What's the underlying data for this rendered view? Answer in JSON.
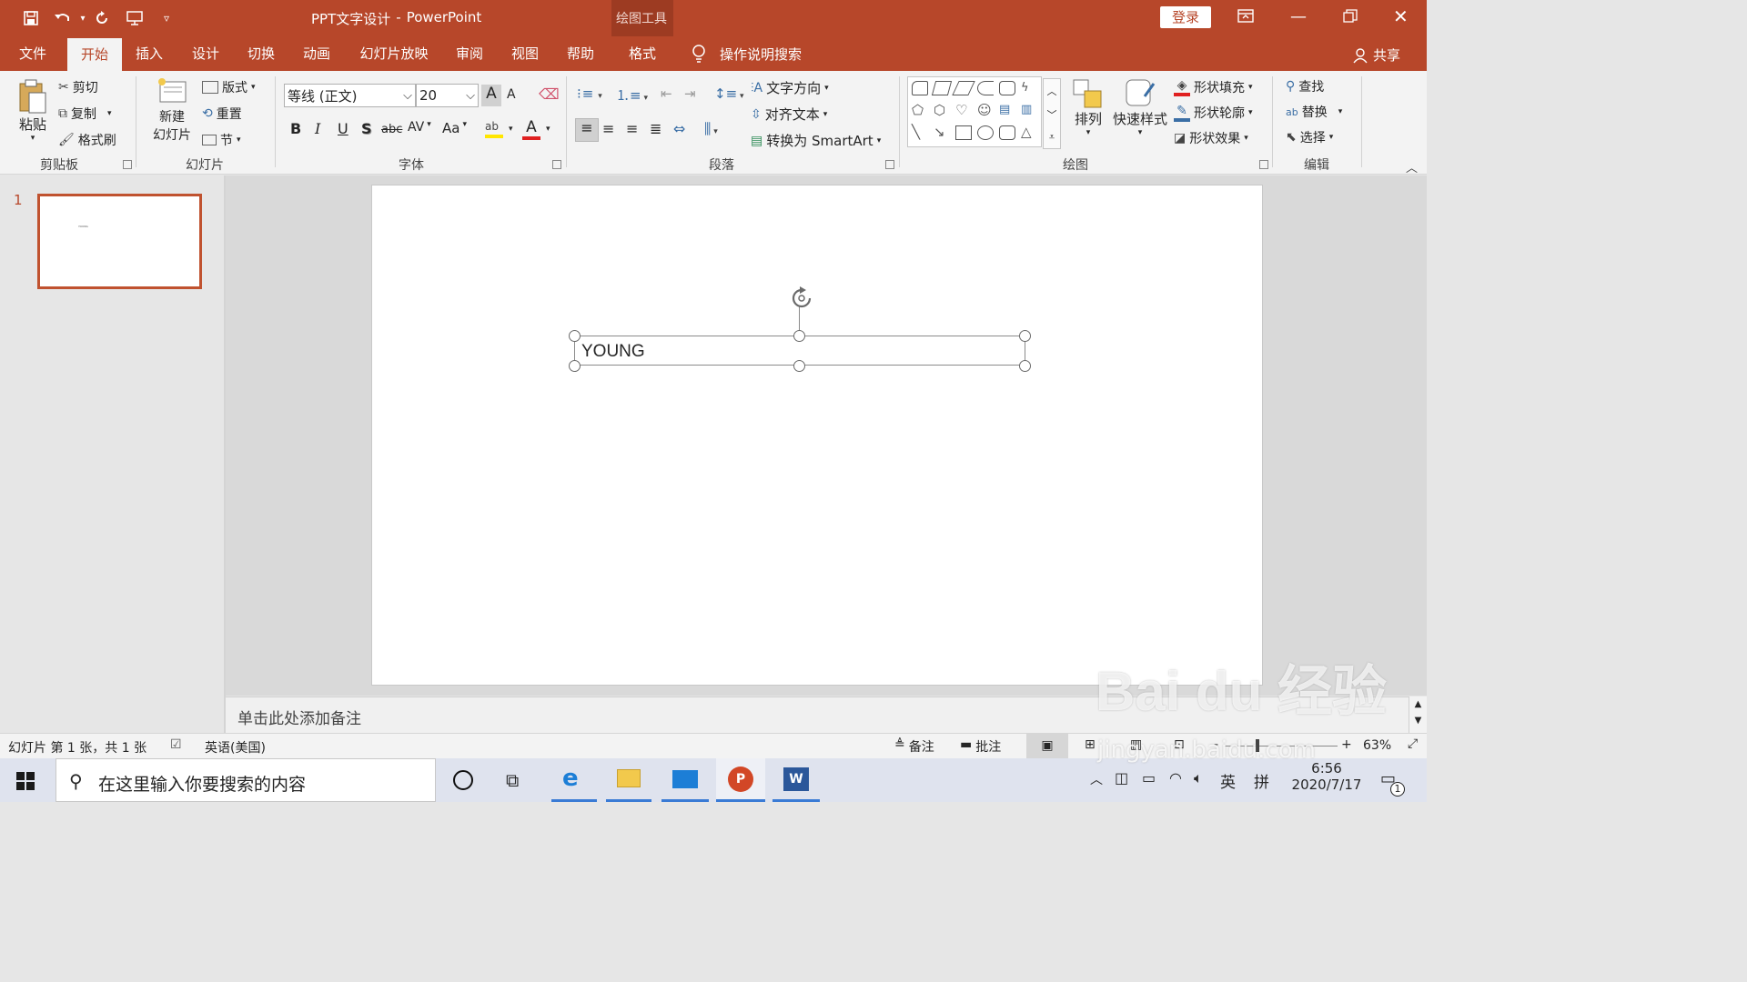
{
  "window": {
    "doc_title": "PPT文字设计",
    "sep": "-",
    "app_name": "PowerPoint",
    "context_label": "绘图工具",
    "login_label": "登录"
  },
  "tabs": [
    "文件",
    "开始",
    "插入",
    "设计",
    "切换",
    "动画",
    "幻灯片放映",
    "审阅",
    "视图",
    "帮助",
    "格式"
  ],
  "tell_me": "操作说明搜索",
  "share_label": "共享",
  "ribbon": {
    "clipboard": {
      "paste": "粘贴",
      "cut": "剪切",
      "copy": "复制",
      "format_painter": "格式刷",
      "label": "剪贴板"
    },
    "slides": {
      "new_slide_1": "新建",
      "new_slide_2": "幻灯片",
      "layout": "版式",
      "reset": "重置",
      "section": "节",
      "label": "幻灯片"
    },
    "font": {
      "font_name": "等线 (正文)",
      "font_size": "20",
      "bold": "B",
      "italic": "I",
      "underline": "U",
      "shadow": "S",
      "strike": "abc",
      "spacing": "AV",
      "case": "Aa",
      "grow": "A",
      "shrink": "A",
      "label": "字体"
    },
    "paragraph": {
      "text_direction": "文字方向",
      "align_text": "对齐文本",
      "smartart": "转换为 SmartArt",
      "label": "段落"
    },
    "drawing": {
      "arrange": "排列",
      "quick_styles": "快速样式",
      "fill": "形状填充",
      "outline": "形状轮廓",
      "effects": "形状效果",
      "label": "绘图"
    },
    "editing": {
      "find": "查找",
      "replace": "替换",
      "select": "选择",
      "label": "编辑"
    }
  },
  "thumbnails": [
    {
      "number": "1",
      "preview_text": "YOUNG"
    }
  ],
  "slide": {
    "text": "YOUNG"
  },
  "notes_placeholder": "单击此处添加备注",
  "status": {
    "slide_info": "幻灯片 第 1 张，共 1 张",
    "language": "英语(美国)",
    "notes": "备注",
    "comments": "批注",
    "zoom_minus": "-",
    "zoom_plus": "+",
    "zoom": "63%"
  },
  "taskbar": {
    "search_placeholder": "在这里输入你要搜索的内容",
    "ime_lang": "英",
    "ime_mode": "拼",
    "time": "6:56",
    "date": "2020/7/17",
    "notif_count": "1"
  },
  "watermark": {
    "text": "Bai du 经验",
    "url": "jingyan.baidu.com"
  },
  "colors": {
    "accent": "#b7472a",
    "context_tab": "#9d3b22",
    "ribbon_bg": "#f3f3f3",
    "taskbar_bg": "#dfe3ee"
  }
}
